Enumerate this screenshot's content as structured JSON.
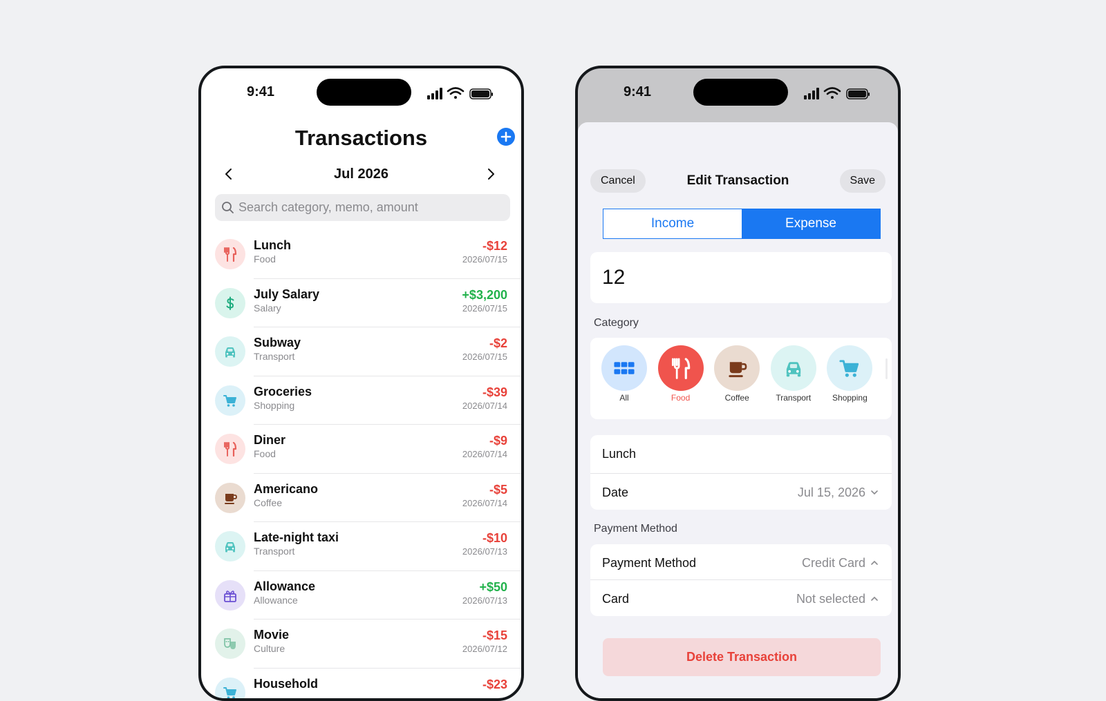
{
  "status": {
    "time": "9:41"
  },
  "transactions_screen": {
    "title": "Transactions",
    "month": "Jul 2026",
    "search": {
      "placeholder": "Search category, memo, amount",
      "value": ""
    },
    "items": [
      {
        "name": "Lunch",
        "category": "Food",
        "amount": "-$12",
        "date": "2026/07/15",
        "icon": "fork-knife-icon",
        "icon_color": "#e8605a",
        "icon_bg": "#fde3e2",
        "type": "expense"
      },
      {
        "name": "July Salary",
        "category": "Salary",
        "amount": "+$3,200",
        "date": "2026/07/15",
        "icon": "dollar-icon",
        "icon_color": "#1dab7e",
        "icon_bg": "#d9f4ec",
        "type": "income"
      },
      {
        "name": "Subway",
        "category": "Transport",
        "amount": "-$2",
        "date": "2026/07/15",
        "icon": "car-icon",
        "icon_color": "#4fc3bf",
        "icon_bg": "#dcf4f3",
        "type": "expense"
      },
      {
        "name": "Groceries",
        "category": "Shopping",
        "amount": "-$39",
        "date": "2026/07/14",
        "icon": "cart-icon",
        "icon_color": "#3cb2d6",
        "icon_bg": "#dcf1f8",
        "type": "expense"
      },
      {
        "name": "Diner",
        "category": "Food",
        "amount": "-$9",
        "date": "2026/07/14",
        "icon": "fork-knife-icon",
        "icon_color": "#e8605a",
        "icon_bg": "#fde3e2",
        "type": "expense"
      },
      {
        "name": "Americano",
        "category": "Coffee",
        "amount": "-$5",
        "date": "2026/07/14",
        "icon": "coffee-icon",
        "icon_color": "#7a3b1c",
        "icon_bg": "#eadbd0",
        "type": "expense"
      },
      {
        "name": "Late-night taxi",
        "category": "Transport",
        "amount": "-$10",
        "date": "2026/07/13",
        "icon": "car-icon",
        "icon_color": "#4fc3bf",
        "icon_bg": "#dcf4f3",
        "type": "expense"
      },
      {
        "name": "Allowance",
        "category": "Allowance",
        "amount": "+$50",
        "date": "2026/07/13",
        "icon": "gift-icon",
        "icon_color": "#6a4fd3",
        "icon_bg": "#e6e0f8",
        "type": "income"
      },
      {
        "name": "Movie",
        "category": "Culture",
        "amount": "-$15",
        "date": "2026/07/12",
        "icon": "theater-masks-icon",
        "icon_color": "#7fc3a5",
        "icon_bg": "#e2f2ea",
        "type": "expense"
      },
      {
        "name": "Household",
        "category": "",
        "amount": "-$23",
        "date": "",
        "icon": "cart-icon",
        "icon_color": "#3cb2d6",
        "icon_bg": "#dcf1f8",
        "type": "expense"
      }
    ]
  },
  "edit_screen": {
    "cancel": "Cancel",
    "title": "Edit Transaction",
    "save": "Save",
    "segment": {
      "income": "Income",
      "expense": "Expense",
      "selected": "Expense"
    },
    "amount": "12",
    "category_label": "Category",
    "categories": [
      {
        "label": "All",
        "icon": "grid-icon",
        "color": "#1a78f2",
        "bg": "#d2e6fd"
      },
      {
        "label": "Food",
        "icon": "fork-knife-icon",
        "color": "#ffffff",
        "bg": "#f0544d",
        "selected": true
      },
      {
        "label": "Coffee",
        "icon": "coffee-icon",
        "color": "#7a3b1c",
        "bg": "#eadbd0"
      },
      {
        "label": "Transport",
        "icon": "car-icon",
        "color": "#4fc3bf",
        "bg": "#dcf4f3"
      },
      {
        "label": "Shopping",
        "icon": "cart-icon",
        "color": "#3cb2d6",
        "bg": "#dcf1f8"
      }
    ],
    "memo": "Lunch",
    "date_label": "Date",
    "date_value": "Jul 15, 2026",
    "payment_section_label": "Payment Method",
    "payment_label": "Payment Method",
    "payment_value": "Credit Card",
    "card_label": "Card",
    "card_value": "Not selected",
    "delete": "Delete Transaction"
  },
  "colors": {
    "accent": "#1a78f2",
    "expense": "#e8423a",
    "income": "#22b24c"
  }
}
